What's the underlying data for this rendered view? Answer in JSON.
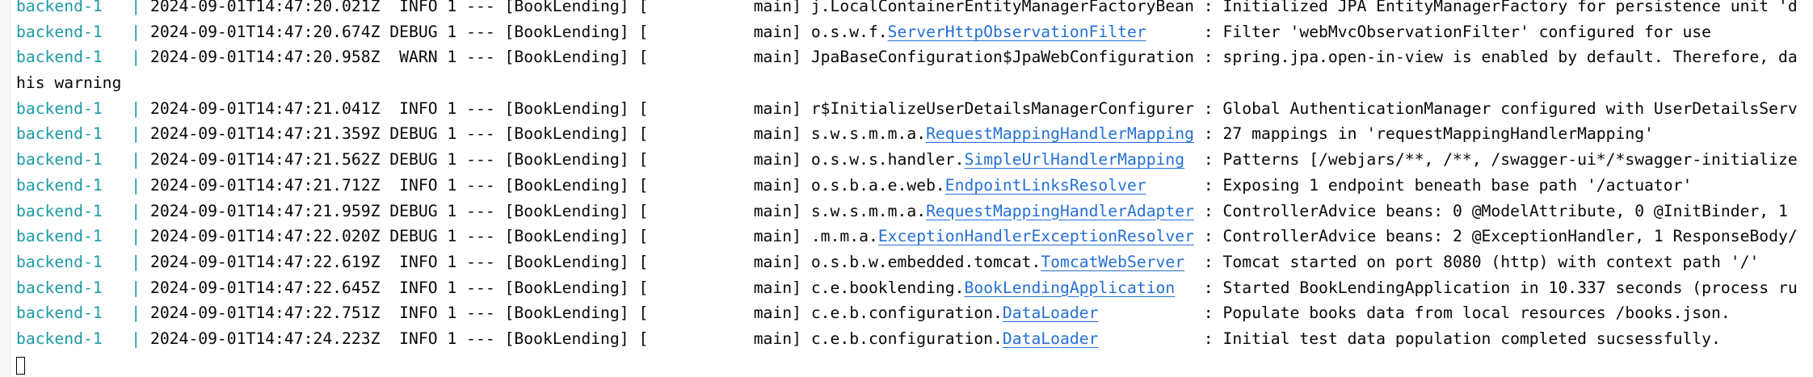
{
  "terminal": {
    "colors": {
      "service": "#1b9aa6",
      "text": "#080808",
      "link": "#2470d6",
      "background": "#ffffff"
    },
    "lines": [
      {
        "service": "backend-1",
        "ts": "2024-09-01T14:47:20.021Z",
        "level": "INFO",
        "pid": "1",
        "app": "BookLending",
        "thread": "main",
        "pkg": "j.LocalContainerEntityManagerFactoryBean",
        "cls": "",
        "message": "Initialized JPA EntityManagerFactory for persistence unit 'd"
      },
      {
        "service": "backend-1",
        "ts": "2024-09-01T14:47:20.674Z",
        "level": "DEBUG",
        "pid": "1",
        "app": "BookLending",
        "thread": "main",
        "pkg": "o.s.w.f.",
        "cls": "ServerHttpObservationFilter",
        "message": "Filter 'webMvcObservationFilter' configured for use"
      },
      {
        "service": "backend-1",
        "ts": "2024-09-01T14:47:20.958Z",
        "level": "WARN",
        "pid": "1",
        "app": "BookLending",
        "thread": "main",
        "pkg": "JpaBaseConfiguration$JpaWebConfiguration",
        "cls": "",
        "message": "spring.jpa.open-in-view is enabled by default. Therefore, da"
      },
      {
        "continuation": "his warning"
      },
      {
        "service": "backend-1",
        "ts": "2024-09-01T14:47:21.041Z",
        "level": "INFO",
        "pid": "1",
        "app": "BookLending",
        "thread": "main",
        "pkg": "r$InitializeUserDetailsManagerConfigurer",
        "cls": "",
        "message": "Global AuthenticationManager configured with UserDetailsServ"
      },
      {
        "service": "backend-1",
        "ts": "2024-09-01T14:47:21.359Z",
        "level": "DEBUG",
        "pid": "1",
        "app": "BookLending",
        "thread": "main",
        "pkg": "s.w.s.m.m.a.",
        "cls": "RequestMappingHandlerMapping",
        "message": "27 mappings in 'requestMappingHandlerMapping'"
      },
      {
        "service": "backend-1",
        "ts": "2024-09-01T14:47:21.562Z",
        "level": "DEBUG",
        "pid": "1",
        "app": "BookLending",
        "thread": "main",
        "pkg": "o.s.w.s.handler.",
        "cls": "SimpleUrlHandlerMapping",
        "message": "Patterns [/webjars/**, /**, /swagger-ui*/*swagger-initialize"
      },
      {
        "service": "backend-1",
        "ts": "2024-09-01T14:47:21.712Z",
        "level": "INFO",
        "pid": "1",
        "app": "BookLending",
        "thread": "main",
        "pkg": "o.s.b.a.e.web.",
        "cls": "EndpointLinksResolver",
        "message": "Exposing 1 endpoint beneath base path '/actuator'"
      },
      {
        "service": "backend-1",
        "ts": "2024-09-01T14:47:21.959Z",
        "level": "DEBUG",
        "pid": "1",
        "app": "BookLending",
        "thread": "main",
        "pkg": "s.w.s.m.m.a.",
        "cls": "RequestMappingHandlerAdapter",
        "message": "ControllerAdvice beans: 0 @ModelAttribute, 0 @InitBinder, 1 "
      },
      {
        "service": "backend-1",
        "ts": "2024-09-01T14:47:22.020Z",
        "level": "DEBUG",
        "pid": "1",
        "app": "BookLending",
        "thread": "main",
        "pkg": ".m.m.a.",
        "cls": "ExceptionHandlerExceptionResolver",
        "message": "ControllerAdvice beans: 2 @ExceptionHandler, 1 ResponseBody/"
      },
      {
        "service": "backend-1",
        "ts": "2024-09-01T14:47:22.619Z",
        "level": "INFO",
        "pid": "1",
        "app": "BookLending",
        "thread": "main",
        "pkg": "o.s.b.w.embedded.tomcat.",
        "cls": "TomcatWebServer",
        "message": "Tomcat started on port 8080 (http) with context path '/'"
      },
      {
        "service": "backend-1",
        "ts": "2024-09-01T14:47:22.645Z",
        "level": "INFO",
        "pid": "1",
        "app": "BookLending",
        "thread": "main",
        "pkg": "c.e.booklending.",
        "cls": "BookLendingApplication",
        "message": "Started BookLendingApplication in 10.337 seconds (process ru"
      },
      {
        "service": "backend-1",
        "ts": "2024-09-01T14:47:22.751Z",
        "level": "INFO",
        "pid": "1",
        "app": "BookLending",
        "thread": "main",
        "pkg": "c.e.b.configuration.",
        "cls": "DataLoader",
        "message": "Populate books data from local resources /books.json."
      },
      {
        "service": "backend-1",
        "ts": "2024-09-01T14:47:24.223Z",
        "level": "INFO",
        "pid": "1",
        "app": "BookLending",
        "thread": "main",
        "pkg": "c.e.b.configuration.",
        "cls": "DataLoader",
        "message": "Initial test data population completed sucsessfully."
      }
    ]
  }
}
